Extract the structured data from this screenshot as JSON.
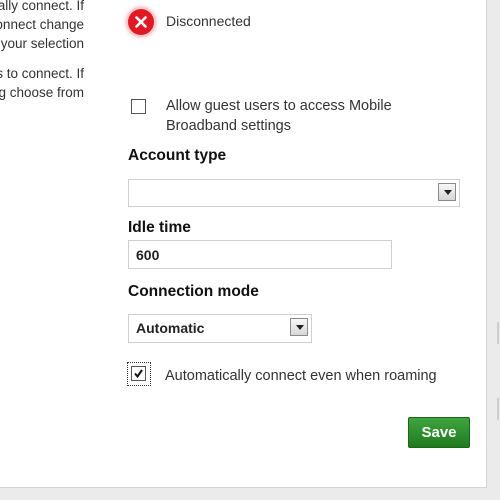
{
  "left_text": {
    "para1": [
      "cally connect. If",
      "onnect change",
      " your selection"
    ],
    "para2": [
      "gs to connect. If",
      "g choose from"
    ]
  },
  "status": {
    "icon": "error-x-icon",
    "text": "Disconnected",
    "color": "#e01a24"
  },
  "guest_access": {
    "label_line1": "Allow guest users to access Mobile",
    "label_line2": "Broadband settings",
    "checked": false
  },
  "account_type": {
    "label": "Account type",
    "value": ""
  },
  "idle_time": {
    "label": "Idle time",
    "value": "600"
  },
  "connection_mode": {
    "label": "Connection mode",
    "value": "Automatic"
  },
  "roaming": {
    "label": "Automatically connect even when roaming",
    "checked": true
  },
  "save_label": "Save",
  "colors": {
    "save_button": "#2e8b2e",
    "panel_bg": "#ffffff"
  }
}
